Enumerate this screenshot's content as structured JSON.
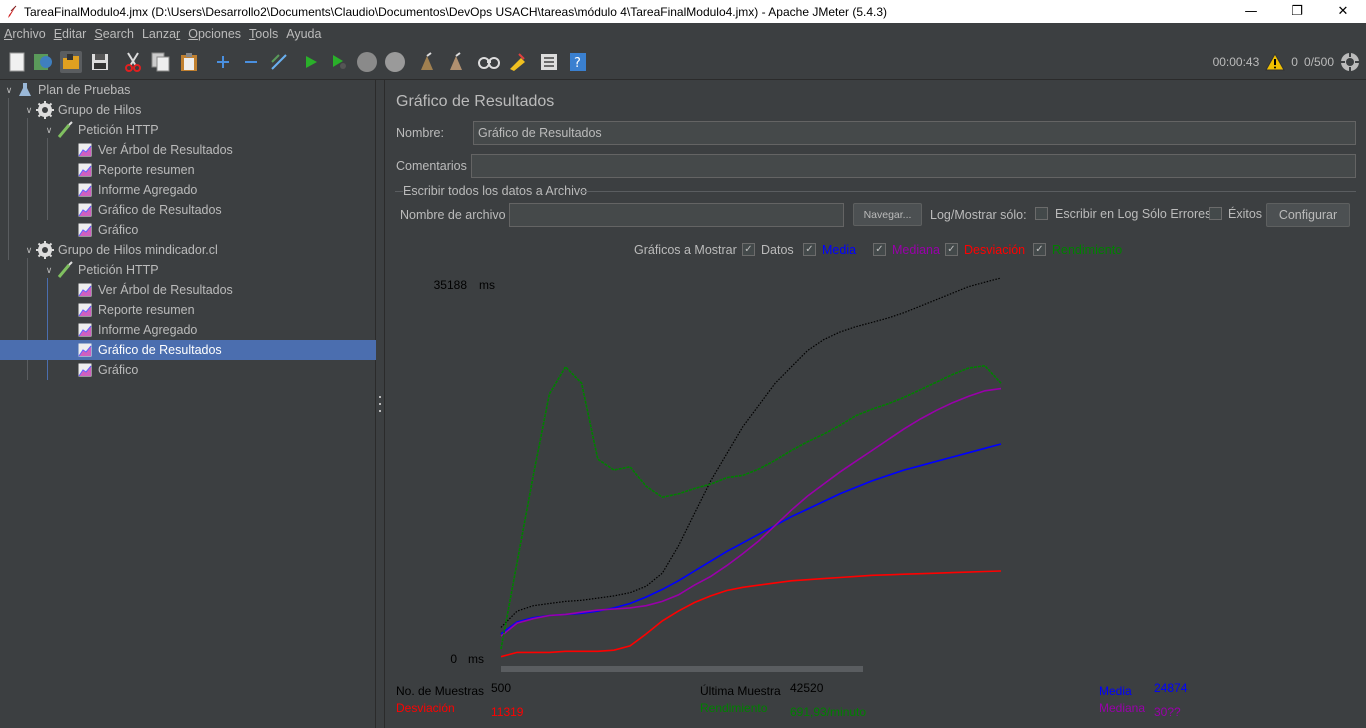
{
  "window": {
    "title": "TareaFinalModulo4.jmx (D:\\Users\\Desarrollo2\\Documents\\Claudio\\Documentos\\DevOps USACH\\tareas\\módulo 4\\TareaFinalModulo4.jmx) - Apache JMeter (5.4.3)",
    "minimize": "—",
    "maximize": "❐",
    "close": "✕"
  },
  "menu": [
    {
      "mn": "A",
      "rest": "rchivo"
    },
    {
      "mn": "E",
      "rest": "ditar"
    },
    {
      "mn": "S",
      "rest": "earch"
    },
    {
      "pre": "Lanza",
      "mn": "r",
      "rest": ""
    },
    {
      "mn": "O",
      "rest": "pciones"
    },
    {
      "mn": "T",
      "rest": "ools"
    },
    {
      "mn": "",
      "rest": "Ayuda"
    }
  ],
  "toolbar": {
    "elapsed": "00:00:43",
    "warnings": "0",
    "threads": "0/500"
  },
  "tree": [
    {
      "label": "Plan de Pruebas",
      "icon": "flask-icon"
    },
    {
      "label": "Grupo de Hilos",
      "icon": "gear-icon"
    },
    {
      "label": "Petición HTTP",
      "icon": "pipette-icon"
    },
    {
      "label": "Ver Árbol de Resultados",
      "icon": "graph-icon"
    },
    {
      "label": "Reporte resumen",
      "icon": "graph-icon"
    },
    {
      "label": "Informe Agregado",
      "icon": "graph-icon"
    },
    {
      "label": "Gráfico de Resultados",
      "icon": "graph-icon"
    },
    {
      "label": "Gráfico",
      "icon": "graph-icon"
    },
    {
      "label": "Grupo de Hilos mindicador.cl",
      "icon": "gear-icon"
    },
    {
      "label": "Petición HTTP",
      "icon": "pipette-icon"
    },
    {
      "label": "Ver Árbol de Resultados",
      "icon": "graph-icon"
    },
    {
      "label": "Reporte resumen",
      "icon": "graph-icon"
    },
    {
      "label": "Informe Agregado",
      "icon": "graph-icon"
    },
    {
      "label": "Gráfico de Resultados",
      "icon": "graph-icon"
    },
    {
      "label": "Gráfico",
      "icon": "graph-icon"
    }
  ],
  "panel": {
    "title": "Gráfico de Resultados",
    "name_label": "Nombre:",
    "name_value": "Gráfico de Resultados",
    "comments_label": "Comentarios",
    "comments_value": "",
    "file_section": "Escribir todos los datos a Archivo",
    "filename_label": "Nombre de archivo",
    "filename_value": "",
    "browse_button": "Navegar...",
    "log_label": "Log/Mostrar sólo:",
    "errors_only_label": "Escribir en Log Sólo Errores",
    "success_label": "Éxitos",
    "configure_button": "Configurar",
    "graphs_label": "Gráficos a Mostrar",
    "toggles": [
      {
        "label": "Datos",
        "color": "#000000",
        "checked": true
      },
      {
        "label": "Media",
        "color": "#0000ff",
        "checked": true
      },
      {
        "label": "Mediana",
        "color": "#9900aa",
        "checked": true
      },
      {
        "label": "Desviación",
        "color": "#ff0000",
        "checked": true
      },
      {
        "label": "Rendimiento",
        "color": "#008000",
        "checked": true
      }
    ]
  },
  "chart_data": {
    "type": "line",
    "y_max_label": "35188",
    "y_min_label": "0",
    "y_unit": "ms",
    "ylim": [
      0,
      35188
    ],
    "series": [
      {
        "name": "Datos",
        "color": "#000000",
        "values": [
          3000,
          4500,
          5000,
          5200,
          5400,
          5500,
          5700,
          5900,
          6200,
          6800,
          8000,
          10500,
          13500,
          16500,
          19000,
          21500,
          23500,
          25500,
          27000,
          28500,
          29500,
          30200,
          30700,
          31100,
          31500,
          32000,
          32600,
          33200,
          33800,
          34400,
          34800,
          35188
        ]
      },
      {
        "name": "Media",
        "color": "#0000ff",
        "values": [
          2400,
          3500,
          3900,
          4100,
          4200,
          4300,
          4500,
          4800,
          5200,
          5800,
          6500,
          7300,
          8200,
          9100,
          10000,
          10800,
          11600,
          12400,
          13200,
          13900,
          14600,
          15300,
          15900,
          16500,
          17000,
          17500,
          17900,
          18300,
          18700,
          19100,
          19500,
          19900
        ]
      },
      {
        "name": "Mediana",
        "color": "#9900aa",
        "values": [
          2200,
          3400,
          3800,
          4100,
          4200,
          4400,
          4600,
          4700,
          4800,
          5000,
          5400,
          6000,
          6900,
          7700,
          8700,
          9800,
          11000,
          12400,
          13800,
          15100,
          16200,
          17300,
          18300,
          19300,
          20300,
          21300,
          22200,
          23000,
          23700,
          24300,
          24800,
          25000
        ]
      },
      {
        "name": "Desviación",
        "color": "#ff0000",
        "values": [
          300,
          700,
          700,
          700,
          800,
          800,
          800,
          900,
          1300,
          2400,
          3600,
          4500,
          5300,
          5900,
          6400,
          6700,
          6900,
          7100,
          7300,
          7400,
          7500,
          7600,
          7700,
          7800,
          7850,
          7900,
          7950,
          8000,
          8050,
          8100,
          8150,
          8200
        ]
      },
      {
        "name": "Rendimiento",
        "color": "#008000",
        "values": [
          1000,
          9000,
          17000,
          24500,
          27000,
          25500,
          18500,
          17500,
          17800,
          16000,
          15000,
          15300,
          15800,
          16200,
          16800,
          17000,
          17600,
          18400,
          19300,
          20100,
          20800,
          21600,
          22500,
          23100,
          23600,
          24200,
          24900,
          25600,
          26300,
          26900,
          27100,
          25500
        ]
      }
    ]
  },
  "stats": {
    "samples_label": "No. de Muestras",
    "samples_value": "500",
    "last_sample_label": "Última Muestra",
    "last_sample_value": "42520",
    "avg_label": "Media",
    "avg_value": "24874",
    "deviation_label": "Desviación",
    "deviation_value": "11319",
    "throughput_label": "Rendimiento",
    "throughput_value": "691,93/minuto",
    "median_label": "Mediana",
    "median_value": "30??"
  }
}
